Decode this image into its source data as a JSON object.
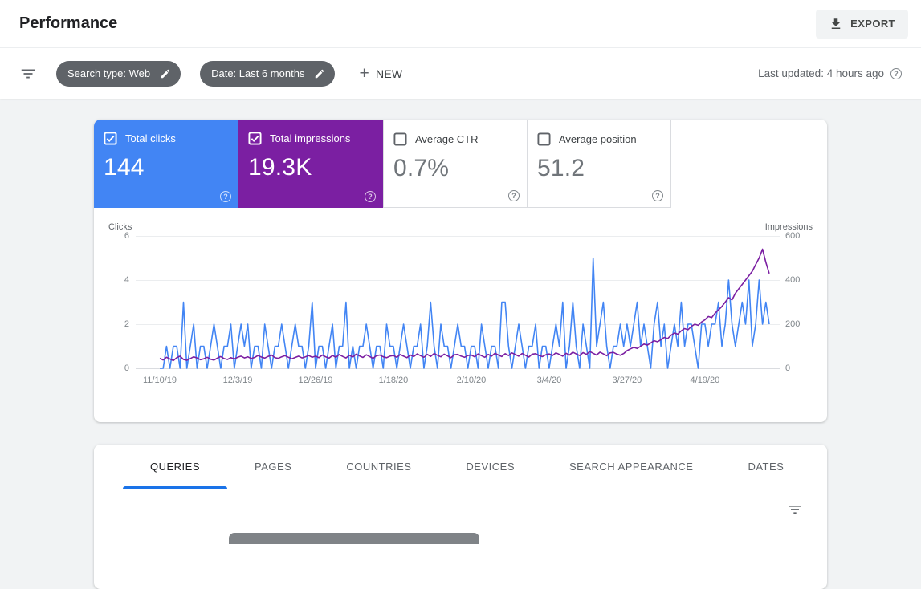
{
  "header": {
    "title": "Performance",
    "export_label": "EXPORT"
  },
  "filter_bar": {
    "search_type_chip": "Search type: Web",
    "date_chip": "Date: Last 6 months",
    "new_label": "NEW",
    "last_updated": "Last updated: 4 hours ago"
  },
  "icons": {
    "plus_glyph": "+",
    "help_glyph": "?"
  },
  "colors": {
    "clicks_blue": "#4285f4",
    "impressions_purple": "#7b1fa2",
    "tab_accent": "#1a73e8"
  },
  "metrics": {
    "clicks": {
      "label": "Total clicks",
      "value": "144",
      "selected": true
    },
    "impressions": {
      "label": "Total impressions",
      "value": "19.3K",
      "selected": true
    },
    "ctr": {
      "label": "Average CTR",
      "value": "0.7%",
      "selected": false
    },
    "position": {
      "label": "Average position",
      "value": "51.2",
      "selected": false
    }
  },
  "table_tabs": [
    "QUERIES",
    "PAGES",
    "COUNTRIES",
    "DEVICES",
    "SEARCH APPEARANCE",
    "DATES"
  ],
  "chart_data": {
    "type": "line",
    "left_axis": {
      "label": "Clicks",
      "ticks": [
        6,
        4,
        2,
        0
      ],
      "range": [
        0,
        6
      ]
    },
    "right_axis": {
      "label": "Impressions",
      "ticks": [
        600,
        400,
        200,
        0
      ],
      "range": [
        0,
        600
      ]
    },
    "x_tick_labels": [
      "11/10/19",
      "12/3/19",
      "12/26/19",
      "1/18/20",
      "2/10/20",
      "3/4/20",
      "3/27/20",
      "4/19/20"
    ],
    "x_tick_positions": [
      0,
      23,
      46,
      69,
      92,
      115,
      138,
      161
    ],
    "x_total_days": 180,
    "grid": true,
    "legend_position": "none",
    "series": [
      {
        "name": "Total clicks",
        "axis": "left",
        "color": "#4285f4",
        "values": [
          0,
          0,
          1,
          0,
          1,
          1,
          0,
          3,
          0,
          1,
          2,
          0,
          1,
          1,
          0,
          1,
          2,
          1,
          0,
          1,
          1,
          2,
          0,
          1,
          2,
          1,
          2,
          0,
          1,
          1,
          0,
          2,
          1,
          0,
          1,
          1,
          2,
          1,
          0,
          1,
          2,
          1,
          1,
          0,
          1,
          3,
          0,
          1,
          1,
          0,
          1,
          2,
          0,
          1,
          1,
          3,
          0,
          1,
          0,
          1,
          1,
          2,
          1,
          0,
          1,
          1,
          0,
          2,
          1,
          1,
          0,
          1,
          2,
          1,
          0,
          1,
          1,
          2,
          0,
          1,
          3,
          1,
          0,
          2,
          1,
          1,
          0,
          1,
          2,
          1,
          1,
          0,
          1,
          1,
          0,
          2,
          1,
          0,
          1,
          1,
          0,
          3,
          3,
          1,
          0,
          1,
          2,
          1,
          0,
          1,
          1,
          2,
          0,
          1,
          1,
          0,
          1,
          2,
          1,
          3,
          0,
          1,
          3,
          1,
          0,
          2,
          1,
          0,
          5,
          1,
          2,
          3,
          1,
          0,
          1,
          1,
          2,
          1,
          2,
          1,
          2,
          3,
          1,
          2,
          1,
          0,
          2,
          3,
          1,
          2,
          0,
          1,
          2,
          1,
          3,
          1,
          2,
          2,
          1,
          0,
          2,
          2,
          1,
          2,
          2,
          3,
          1,
          2,
          4,
          2,
          1,
          2,
          3,
          2,
          4,
          1,
          2,
          4,
          2,
          3,
          2
        ]
      },
      {
        "name": "Total impressions",
        "axis": "right",
        "color": "#7b1fa2",
        "values": [
          45,
          38,
          50,
          42,
          35,
          48,
          55,
          40,
          36,
          44,
          52,
          47,
          39,
          43,
          50,
          41,
          37,
          46,
          53,
          44,
          40,
          48,
          42,
          50,
          55,
          47,
          52,
          44,
          49,
          58,
          51,
          46,
          54,
          60,
          48,
          45,
          52,
          57,
          50,
          43,
          49,
          55,
          47,
          52,
          58,
          50,
          55,
          48,
          60,
          52,
          46,
          58,
          50,
          62,
          54,
          47,
          59,
          51,
          64,
          56,
          49,
          61,
          53,
          45,
          57,
          60,
          52,
          48,
          55,
          58,
          50,
          62,
          55,
          48,
          60,
          53,
          65,
          57,
          50,
          63,
          54,
          67,
          59,
          52,
          64,
          56,
          48,
          61,
          63,
          55,
          50,
          58,
          60,
          52,
          65,
          57,
          50,
          63,
          55,
          68,
          60,
          53,
          66,
          58,
          70,
          62,
          55,
          67,
          59,
          51,
          64,
          66,
          58,
          53,
          61,
          65,
          58,
          70,
          63,
          55,
          68,
          60,
          73,
          65,
          58,
          71,
          63,
          76,
          68,
          60,
          73,
          65,
          57,
          70,
          72,
          64,
          59,
          67,
          80,
          88,
          95,
          90,
          100,
          110,
          105,
          115,
          125,
          120,
          130,
          140,
          135,
          150,
          160,
          155,
          170,
          180,
          175,
          190,
          200,
          195,
          210,
          220,
          235,
          230,
          250,
          265,
          280,
          300,
          320,
          310,
          340,
          360,
          380,
          400,
          420,
          440,
          470,
          500,
          540,
          480,
          430
        ]
      }
    ]
  }
}
